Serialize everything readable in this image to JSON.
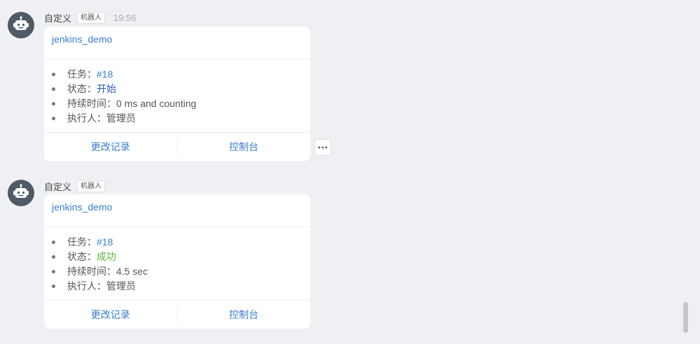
{
  "messages": [
    {
      "sender": "自定义",
      "badge": "机器人",
      "time": "19:56",
      "card": {
        "title": "jenkins_demo",
        "fields": [
          {
            "label": "任务：",
            "value": "#18"
          },
          {
            "label": "状态：",
            "value": "开始"
          },
          {
            "label": "持续时间：",
            "value": "0 ms and counting"
          },
          {
            "label": "执行人：",
            "value": "管理员"
          }
        ],
        "actions": [
          "更改记录",
          "控制台"
        ]
      },
      "avatar_icon": "robot-icon",
      "more_icon": "more-horizontal-icon"
    },
    {
      "sender": "自定义",
      "badge": "机器人",
      "card": {
        "title": "jenkins_demo",
        "fields": [
          {
            "label": "任务：",
            "value": "#18"
          },
          {
            "label": "状态：",
            "value": "成功"
          },
          {
            "label": "持续时间：",
            "value": "4.5 sec"
          },
          {
            "label": "执行人：",
            "value": "管理员"
          }
        ],
        "actions": [
          "更改记录",
          "控制台"
        ]
      },
      "avatar_icon": "robot-icon"
    }
  ],
  "colors": {
    "link": "#3b7fc9",
    "status_start": "#2b57b8",
    "status_success": "#5ab336",
    "background": "#eef0f3",
    "avatar": "#4e5a66"
  }
}
